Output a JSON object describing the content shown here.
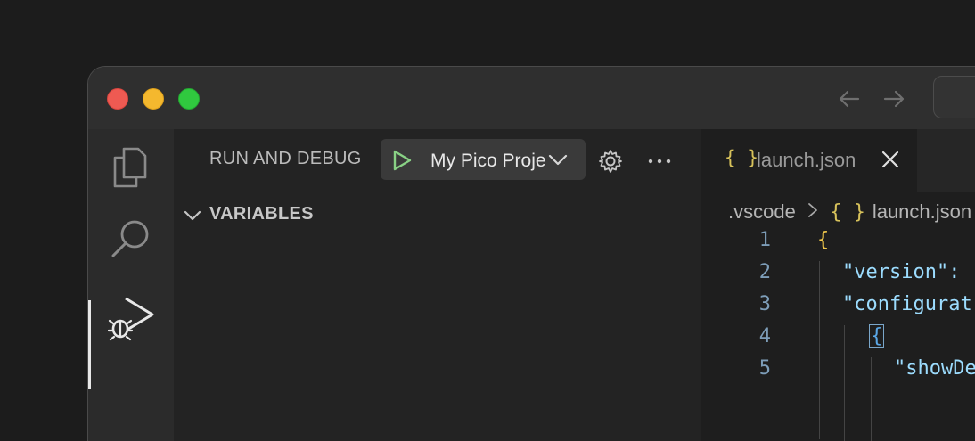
{
  "sidebar": {
    "title": "RUN AND DEBUG",
    "config_label": "My Pico Project",
    "section_variables": "VARIABLES"
  },
  "activity": {
    "items": [
      {
        "name": "explorer",
        "icon": "files-icon"
      },
      {
        "name": "search",
        "icon": "search-icon"
      },
      {
        "name": "run-and-debug",
        "icon": "run-debug-icon",
        "active": true
      }
    ]
  },
  "editor": {
    "tab": {
      "icon": "{ }",
      "label": "launch.json"
    },
    "breadcrumb": {
      "folder": ".vscode",
      "icon": "{ }",
      "file": "launch.json"
    },
    "lines": [
      {
        "num": "1",
        "text": "{"
      },
      {
        "num": "2",
        "text": "\"version\":"
      },
      {
        "num": "3",
        "text": "\"configurat"
      },
      {
        "num": "4",
        "text": "{"
      },
      {
        "num": "5",
        "text": "\"showDe"
      }
    ]
  },
  "colors": {
    "play_green": "#89d185",
    "json_icon": "#d7c25b",
    "string": "#9cdcfe",
    "brace": "#f2c94c",
    "line_number": "#7d9db8"
  }
}
